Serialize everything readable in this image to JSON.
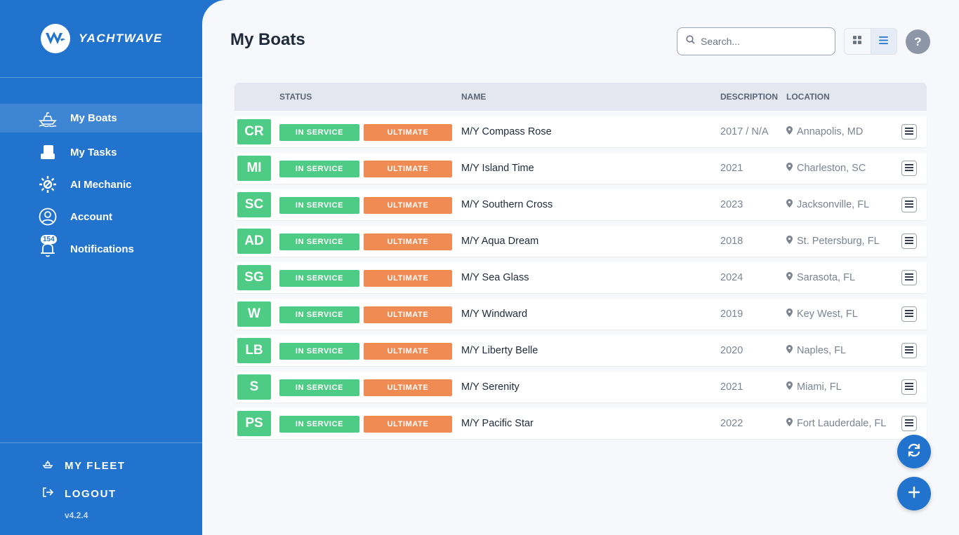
{
  "brand": {
    "name": "YACHTWAVE"
  },
  "sidebar": {
    "items": [
      {
        "label": "My Boats",
        "icon": "boat-icon"
      },
      {
        "label": "My Tasks",
        "icon": "tasks-icon"
      },
      {
        "label": "AI Mechanic",
        "icon": "gear-icon"
      },
      {
        "label": "Account",
        "icon": "account-icon"
      },
      {
        "label": "Notifications",
        "icon": "bell-icon",
        "badge": "154"
      }
    ],
    "bottom": [
      {
        "label": "MY FLEET",
        "icon": "fleet-icon"
      },
      {
        "label": "LOGOUT",
        "icon": "logout-icon"
      }
    ],
    "version": "v4.2.4"
  },
  "main": {
    "title": "My Boats",
    "search": {
      "placeholder": "Search...",
      "value": ""
    },
    "columns": {
      "status": "STATUS",
      "name": "NAME",
      "description": "DESCRIPTION",
      "location": "LOCATION"
    },
    "rows": [
      {
        "initials": "CR",
        "status": "IN SERVICE",
        "plan": "ULTIMATE",
        "name": "M/Y Compass Rose",
        "description": "2017 / N/A",
        "location": "Annapolis, MD"
      },
      {
        "initials": "MI",
        "status": "IN SERVICE",
        "plan": "ULTIMATE",
        "name": "M/Y Island Time",
        "description": "2021",
        "location": "Charleston, SC"
      },
      {
        "initials": "SC",
        "status": "IN SERVICE",
        "plan": "ULTIMATE",
        "name": "M/Y Southern Cross",
        "description": "2023",
        "location": "Jacksonville, FL"
      },
      {
        "initials": "AD",
        "status": "IN SERVICE",
        "plan": "ULTIMATE",
        "name": "M/Y Aqua Dream",
        "description": "2018",
        "location": "St. Petersburg, FL"
      },
      {
        "initials": "SG",
        "status": "IN SERVICE",
        "plan": "ULTIMATE",
        "name": "M/Y Sea Glass",
        "description": "2024",
        "location": "Sarasota, FL"
      },
      {
        "initials": "W",
        "status": "IN SERVICE",
        "plan": "ULTIMATE",
        "name": "M/Y Windward",
        "description": "2019",
        "location": "Key West, FL"
      },
      {
        "initials": "LB",
        "status": "IN SERVICE",
        "plan": "ULTIMATE",
        "name": "M/Y Liberty Belle",
        "description": "2020",
        "location": "Naples, FL"
      },
      {
        "initials": "S",
        "status": "IN SERVICE",
        "plan": "ULTIMATE",
        "name": "M/Y Serenity",
        "description": "2021",
        "location": "Miami, FL"
      },
      {
        "initials": "PS",
        "status": "IN SERVICE",
        "plan": "ULTIMATE",
        "name": "M/Y Pacific Star",
        "description": "2022",
        "location": "Fort Lauderdale, FL"
      }
    ],
    "help_label": "?"
  },
  "colors": {
    "primary": "#2273cd",
    "status_green": "#4ecb84",
    "plan_orange": "#f08b54"
  }
}
